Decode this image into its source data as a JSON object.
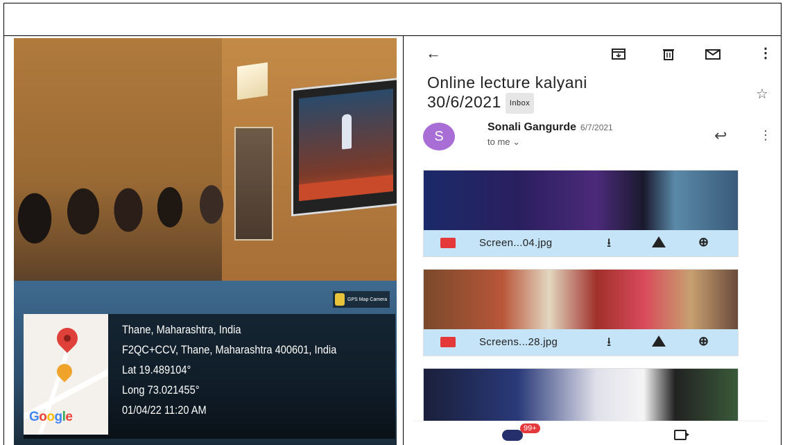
{
  "photo": {
    "gps_camera_label": "GPS Map Camera",
    "map_brand": "Google",
    "location_lines": [
      "Thane, Maharashtra, India",
      "F2QC+CCV, Thane, Maharashtra 400601, India",
      "Lat 19.489104°",
      "Long 73.021455°",
      "01/04/22 11:20 AM"
    ]
  },
  "email": {
    "subject": "Online lecture kalyani 30/6/2021",
    "label": "Inbox",
    "sender_initial": "S",
    "sender_name": "Sonali Gangurde",
    "date": "6/7/2021",
    "recipient": "to me",
    "attachments": [
      {
        "name": "Screen...04.jpg"
      },
      {
        "name": "Screens...28.jpg"
      }
    ],
    "unread_badge": "99+",
    "icons": {
      "back": "arrow-left-icon",
      "archive": "archive-icon",
      "delete": "trash-icon",
      "mark": "mail-icon",
      "more": "more-vert-icon",
      "star": "star-icon",
      "reply": "reply-icon"
    }
  }
}
